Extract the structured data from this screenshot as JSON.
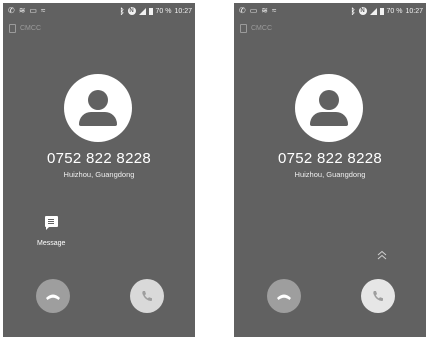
{
  "status_bar": {
    "battery_percent": "70 %",
    "time": "10:27"
  },
  "carrier": "CMCC",
  "call": {
    "number": "0752 822 8228",
    "location": "Huizhou, Guangdong"
  },
  "left_screen": {
    "message_label": "Message"
  },
  "colors": {
    "background": "#616161",
    "decline_button": "#9e9e9e",
    "answer_button": "#d9d9d9",
    "text": "#ffffff"
  },
  "icons": [
    "missed-call-icon",
    "wifi-call-icon",
    "image-icon",
    "wifi-icon",
    "bluetooth-icon",
    "nfc-icon",
    "signal-icon",
    "battery-icon",
    "sim-icon",
    "contact-avatar-icon",
    "message-icon",
    "chevron-up-icon",
    "end-call-icon",
    "answer-call-icon"
  ]
}
